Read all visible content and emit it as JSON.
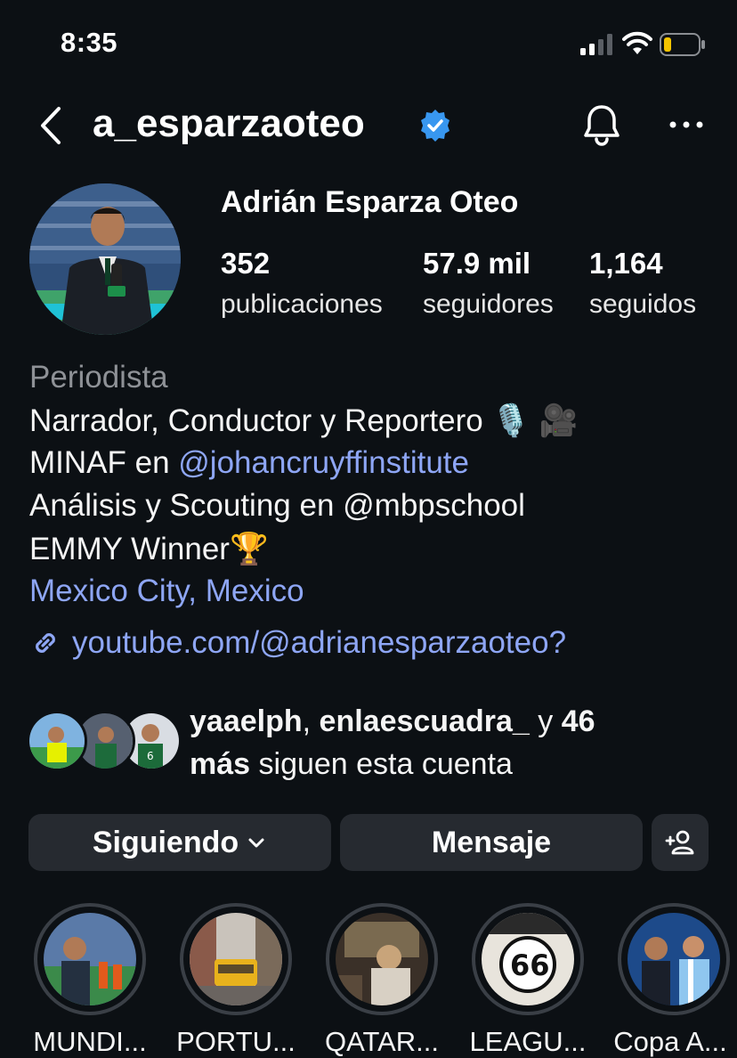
{
  "status_bar": {
    "time": "8:35"
  },
  "header": {
    "username": "a_esparzaoteo"
  },
  "profile": {
    "display_name": "Adrián Esparza Oteo",
    "stats": [
      {
        "value": "352",
        "label": "publicaciones"
      },
      {
        "value": "57.9 mil",
        "label": "seguidores"
      },
      {
        "value": "1,164",
        "label": "seguidos"
      }
    ],
    "category": "Periodista",
    "bio": {
      "line1": "Narrador, Conductor y Reportero",
      "line1_emoji": "🎙️ 🎥",
      "line2_prefix": "MINAF en ",
      "line2_mention": "@johancruyffinstitute",
      "line3": "Análisis y Scouting en @mbpschool",
      "line4": "EMMY Winner",
      "line4_emoji": "🏆",
      "location": "Mexico City, Mexico",
      "website": "youtube.com/@adrianesparzaoteo?"
    }
  },
  "followed_by": {
    "user1": "yaaelph",
    "sep": ", ",
    "user2": "enlaescuadra_",
    "and": " y ",
    "more_count": "46",
    "more_word": "más",
    "suffix": " siguen esta cuenta"
  },
  "actions": {
    "following_label": "Siguiendo",
    "message_label": "Mensaje"
  },
  "highlights": [
    {
      "label": "MUNDI..."
    },
    {
      "label": "PORTU..."
    },
    {
      "label": "QATAR..."
    },
    {
      "label": "LEAGU..."
    },
    {
      "label": "Copa A..."
    }
  ],
  "colors": {
    "background": "#0c1014",
    "link": "#8ea6f5",
    "verified": "#3897f0",
    "button": "#262a30"
  }
}
